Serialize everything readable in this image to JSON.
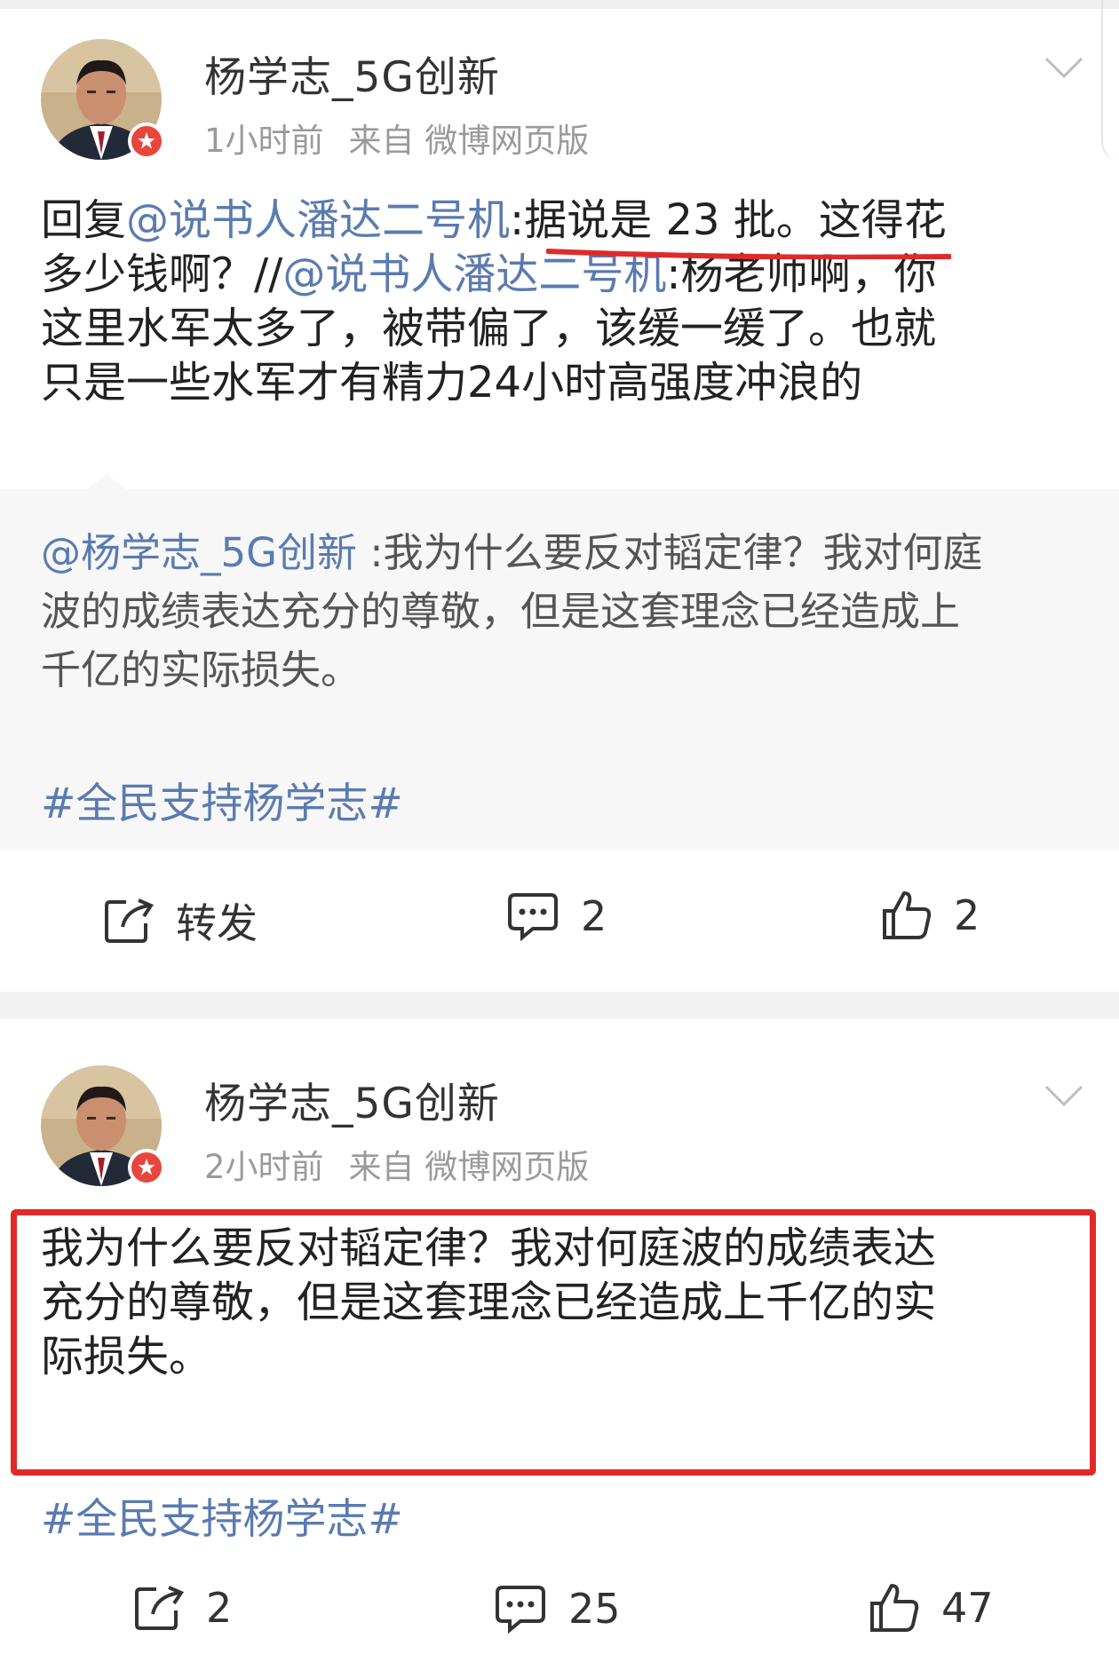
{
  "post1": {
    "username": "杨学志_5G创新",
    "time": "1小时前",
    "source": "来自 微博网页版",
    "reply_prefix": "回复",
    "reply_mention": "@说书人潘达二号机",
    "line1_rest": ":据说是 23 批。这得花",
    "line2_start": "多少钱啊？//",
    "line2_mention": "@说书人潘达二号机",
    "line2_rest": ":杨老师啊，你",
    "line3": "这里水军太多了，被带偏了，该缓一缓了。也就",
    "line4": "只是一些水军才有精力24小时高强度冲浪的",
    "retweet": {
      "mention": "@杨学志_5G创新",
      "line1_rest": " :我为什么要反对韬定律？我对何庭",
      "line2": "波的成绩表达充分的尊敬，但是这套理念已经造成上",
      "line3": "千亿的实际损失。",
      "topic": "#全民支持杨学志#"
    },
    "actions": {
      "repost_label": "转发",
      "comments": "2",
      "likes": "2"
    }
  },
  "post2": {
    "username": "杨学志_5G创新",
    "time": "2小时前",
    "source": "来自 微博网页版",
    "line1": "我为什么要反对韬定律？我对何庭波的成绩表达",
    "line2": "充分的尊敬，但是这套理念已经造成上千亿的实",
    "line3": "际损失。",
    "topic": "#全民支持杨学志#",
    "actions": {
      "reposts": "2",
      "comments": "25",
      "likes": "47"
    }
  },
  "colors": {
    "mention": "#5a7bb0",
    "highlight_box": "#e02a2a",
    "underline": "#e02a2a"
  }
}
